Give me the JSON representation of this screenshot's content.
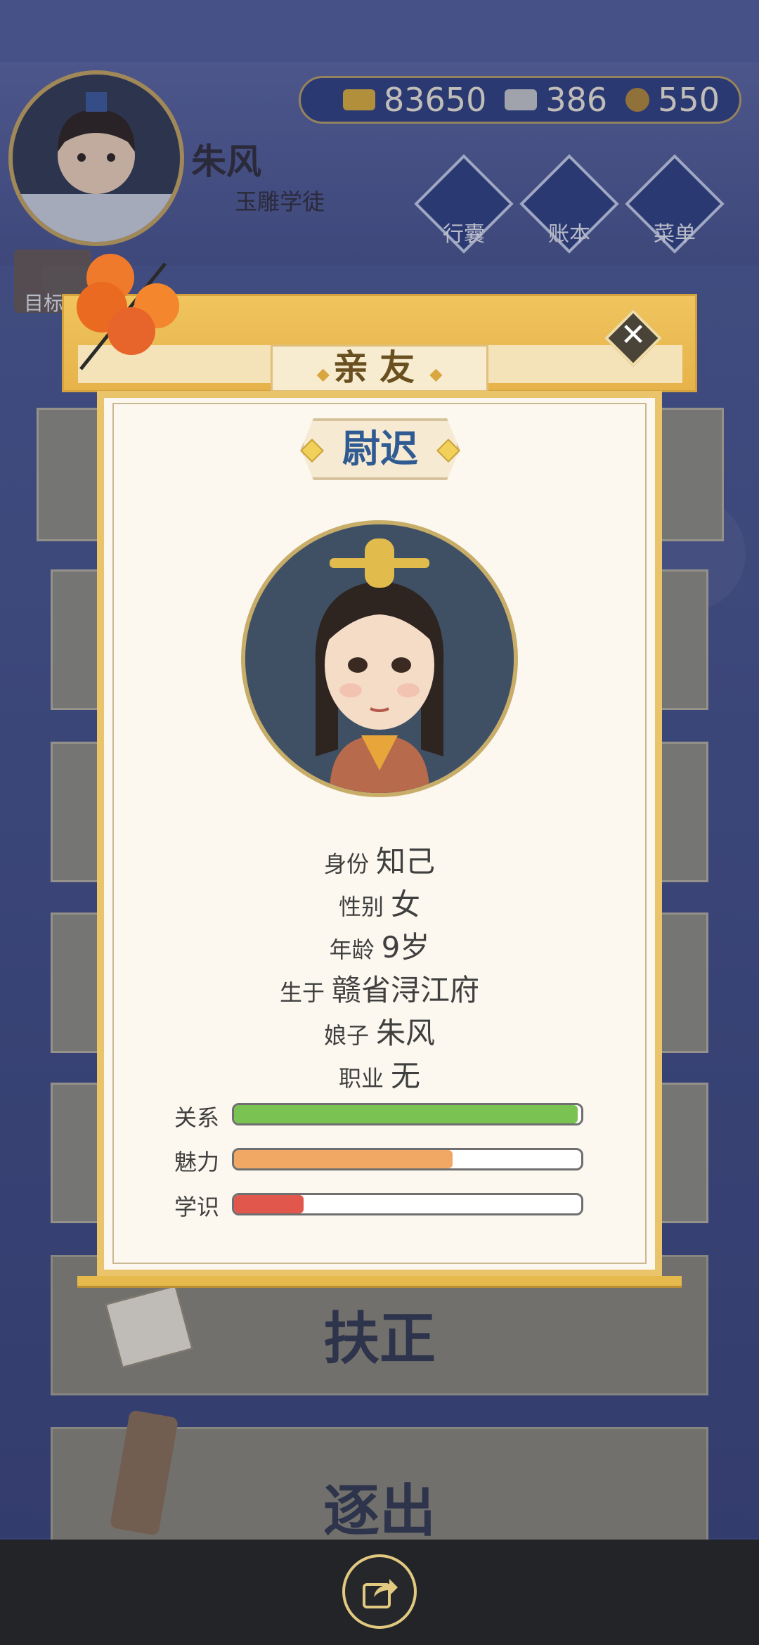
{
  "player": {
    "name": "朱风",
    "title": "玉雕学徒"
  },
  "currency": {
    "gold": "83650",
    "silver": "386",
    "coin": "550"
  },
  "top_buttons": {
    "bag": "行囊",
    "ledger": "账本",
    "menu": "菜单"
  },
  "goal_label": "目标",
  "actions": {
    "promote": "扶正",
    "expel": "逐出"
  },
  "dialog": {
    "title": "亲友",
    "person_name": "尉迟",
    "info": [
      {
        "label": "身份",
        "value": "知己"
      },
      {
        "label": "性别",
        "value": "女"
      },
      {
        "label": "年龄",
        "value": "9岁"
      },
      {
        "label": "生于",
        "value": "赣省浔江府"
      },
      {
        "label": "娘子",
        "value": "朱风"
      },
      {
        "label": "职业",
        "value": "无"
      }
    ],
    "stats": [
      {
        "label": "关系",
        "level": 0.99,
        "color": "#7ac252"
      },
      {
        "label": "魅力",
        "level": 0.63,
        "color": "#f2a865"
      },
      {
        "label": "学识",
        "level": 0.2,
        "color": "#e2574c"
      }
    ]
  },
  "colors": {
    "dialog_gold": "#e9c46a",
    "name_blue": "#2f5b92",
    "scene_blue": "#3d4a86"
  },
  "icons": {
    "close": "close-icon",
    "share": "share-icon"
  }
}
